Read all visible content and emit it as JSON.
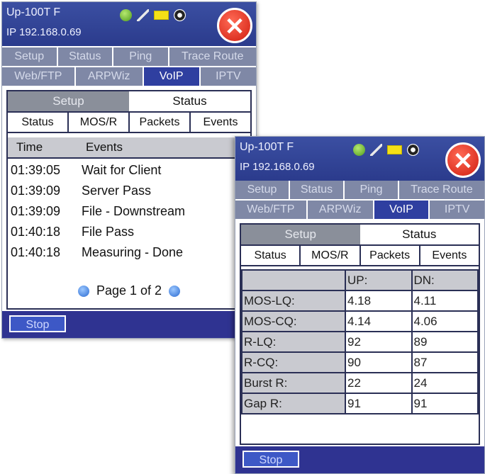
{
  "screens": [
    {
      "device_name": "Up-100T F",
      "ip": "IP 192.168.0.69",
      "icons": [
        "globe-icon",
        "plug-icon",
        "battery-icon",
        "speaker-icon"
      ],
      "close_label": "✕",
      "tabs_row1": [
        "Setup",
        "Status",
        "Ping",
        "Trace Route"
      ],
      "tabs_row2": [
        "Web/FTP",
        "ARPWiz",
        "VoIP",
        "IPTV"
      ],
      "active_tab": "VoIP",
      "subtabs": [
        "Setup",
        "Status"
      ],
      "active_subtab": "Status",
      "viewtabs": [
        "Status",
        "MOS/R",
        "Packets",
        "Events"
      ],
      "active_view": "Events",
      "events": {
        "headers": [
          "Time",
          "Events"
        ],
        "rows": [
          {
            "time": "01:39:05",
            "event": "Wait for Client"
          },
          {
            "time": "01:39:09",
            "event": "Server Pass"
          },
          {
            "time": "01:39:09",
            "event": "File - Downstream"
          },
          {
            "time": "01:40:18",
            "event": "File Pass"
          },
          {
            "time": "01:40:18",
            "event": "Measuring - Done"
          }
        ],
        "pager": "Page 1 of 2"
      },
      "stop_label": "Stop"
    },
    {
      "device_name": "Up-100T F",
      "ip": "IP 192.168.0.69",
      "close_label": "✕",
      "tabs_row1": [
        "Setup",
        "Status",
        "Ping",
        "Trace Route"
      ],
      "tabs_row2": [
        "Web/FTP",
        "ARPWiz",
        "VoIP",
        "IPTV"
      ],
      "active_tab": "VoIP",
      "subtabs": [
        "Setup",
        "Status"
      ],
      "active_subtab": "Status",
      "viewtabs": [
        "Status",
        "MOS/R",
        "Packets",
        "Events"
      ],
      "active_view": "MOS/R",
      "mos": {
        "headers": [
          "",
          "UP:",
          "DN:"
        ],
        "rows": [
          {
            "label": "MOS-LQ:",
            "up": "4.18",
            "dn": "4.11"
          },
          {
            "label": "MOS-CQ:",
            "up": "4.14",
            "dn": "4.06"
          },
          {
            "label": "R-LQ:",
            "up": "92",
            "dn": "89"
          },
          {
            "label": "R-CQ:",
            "up": "90",
            "dn": "87"
          },
          {
            "label": "Burst R:",
            "up": "22",
            "dn": "24"
          },
          {
            "label": "Gap R:",
            "up": "91",
            "dn": "91"
          }
        ]
      },
      "stop_label": "Stop"
    }
  ]
}
